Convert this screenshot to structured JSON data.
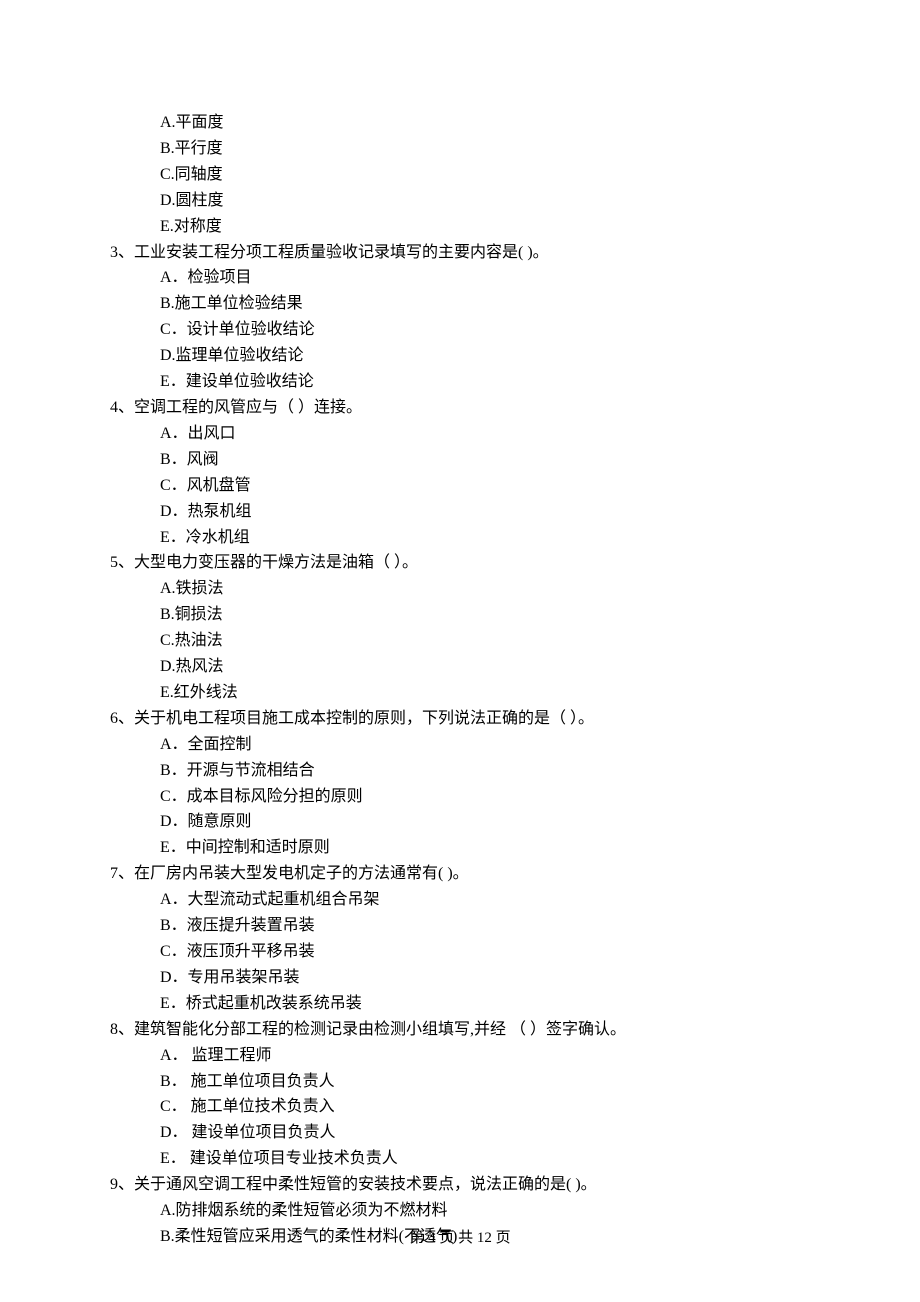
{
  "q2_tail": {
    "options": [
      "A.平面度",
      "B.平行度",
      "C.同轴度",
      "D.圆柱度",
      "E.对称度"
    ]
  },
  "questions": [
    {
      "stem": "3、工业安装工程分项工程质量验收记录填写的主要内容是(  )。",
      "options": [
        "A．检验项目",
        "B.施工单位检验结果",
        "C．设计单位验收结论",
        "D.监理单位验收结论",
        "E．建设单位验收结论"
      ]
    },
    {
      "stem": "4、空调工程的风管应与（    ）连接。",
      "options": [
        "A．出风口",
        "B．风阀",
        "C．风机盘管",
        "D．热泵机组",
        "E．冷水机组"
      ]
    },
    {
      "stem": "5、大型电力变压器的干燥方法是油箱（   ）。",
      "options": [
        "A.铁损法",
        "B.铜损法",
        "C.热油法",
        "D.热风法",
        "E.红外线法"
      ]
    },
    {
      "stem": "6、关于机电工程项目施工成本控制的原则，下列说法正确的是（    ）。",
      "options": [
        "A．全面控制",
        "B．开源与节流相结合",
        "C．成本目标风险分担的原则",
        "D．随意原则",
        "E．中间控制和适时原则"
      ]
    },
    {
      "stem": "7、在厂房内吊装大型发电机定子的方法通常有(     )。",
      "options": [
        "A．大型流动式起重机组合吊架",
        "B．液压提升装置吊装",
        "C．液压顶升平移吊装",
        "D．专用吊装架吊装",
        "E．桥式起重机改装系统吊装"
      ]
    },
    {
      "stem": "8、建筑智能化分部工程的检测记录由检测小组填写,并经 （    ）签字确认。",
      "options": [
        "A． 监理工程师",
        "B． 施工单位项目负责人",
        "C． 施工单位技术负责入",
        "D． 建设单位项目负责人",
        "E． 建设单位项目专业技术负责人"
      ]
    },
    {
      "stem": "9、关于通风空调工程中柔性短管的安装技术要点，说法正确的是(     )。",
      "options": [
        "A.防排烟系统的柔性短管必须为不燃材料",
        "B.柔性短管应采用透气的柔性材料(不透气)"
      ]
    }
  ],
  "footer": "第 4 页 共 12 页"
}
